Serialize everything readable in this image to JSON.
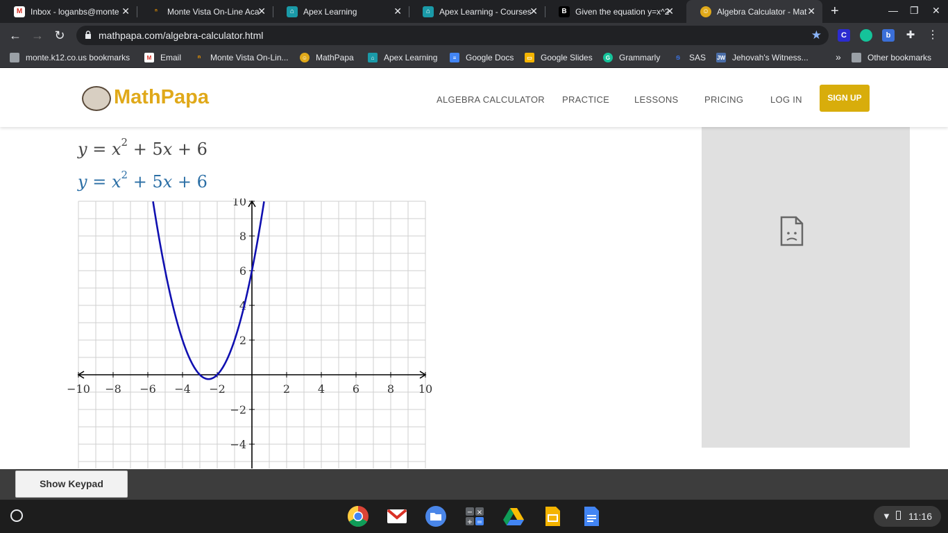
{
  "browser": {
    "tabs": [
      {
        "title": "Inbox - loganbs@monte",
        "icon": "gmail-icon"
      },
      {
        "title": "Monte Vista On-Line Aca",
        "icon": "monte-vista-icon"
      },
      {
        "title": "Apex Learning",
        "icon": "apex-icon"
      },
      {
        "title": "Apex Learning - Courses",
        "icon": "apex-icon"
      },
      {
        "title": "Given the equation y=x^2",
        "icon": "brainly-icon"
      },
      {
        "title": "Algebra Calculator - Mat",
        "icon": "mathpapa-icon",
        "active": true
      }
    ],
    "new_tab": "+",
    "url": "mathpapa.com/algebra-calculator.html",
    "extensions": [
      "C",
      "",
      "b"
    ],
    "bookmarks": [
      {
        "label": "monte.k12.co.us bookmarks",
        "icon": "folder-icon"
      },
      {
        "label": "Email",
        "icon": "gmail-icon"
      },
      {
        "label": "Monte Vista On-Lin...",
        "icon": "monte-vista-icon"
      },
      {
        "label": "MathPapa",
        "icon": "mathpapa-icon"
      },
      {
        "label": "Apex Learning",
        "icon": "apex-icon"
      },
      {
        "label": "Google Docs",
        "icon": "docs-icon"
      },
      {
        "label": "Google Slides",
        "icon": "slides-icon"
      },
      {
        "label": "Grammarly",
        "icon": "grammarly-icon"
      },
      {
        "label": "SAS",
        "icon": "sas-icon"
      },
      {
        "label": "Jehovah's Witness...",
        "icon": "jw-icon"
      }
    ],
    "overflow": "»",
    "other_bookmarks": "Other bookmarks"
  },
  "site": {
    "logo": "MathPapa",
    "nav": [
      "ALGEBRA CALCULATOR",
      "PRACTICE",
      "LESSONS",
      "PRICING",
      "LOG IN"
    ],
    "signup": "SIGN UP",
    "brand_color": "#d8ad0b"
  },
  "equation": {
    "lhs": "y",
    "eq": "=",
    "term1": "x",
    "exp": "2",
    "rest": "+ 5",
    "term2": "x",
    "const": "+ 6",
    "answer_color": "#2a6ea5"
  },
  "keypad": {
    "label": "Show Keypad"
  },
  "shelf": {
    "apps": [
      "chrome-icon",
      "gmail-icon",
      "files-icon",
      "calculator-icon",
      "drive-icon",
      "slides-icon",
      "docs-icon"
    ],
    "time": "11:16"
  },
  "chart_data": {
    "type": "line",
    "function": "y = x^2 + 5x + 6",
    "title": "",
    "xlabel": "",
    "ylabel": "",
    "xlim": [
      -10,
      10
    ],
    "ylim": [
      -5.4,
      10
    ],
    "x_ticks": [
      -10,
      -8,
      -6,
      -4,
      -2,
      2,
      4,
      6,
      8,
      10
    ],
    "y_ticks": [
      10,
      8,
      6,
      4,
      2,
      -2,
      -4
    ],
    "grid": true,
    "series": [
      {
        "color": "#1010b0",
        "x": [
          -5.7,
          -5.5,
          -5,
          -4.5,
          -4,
          -3.5,
          -3,
          -2.5,
          -2,
          -1.5,
          -1,
          -0.5,
          0,
          0.5,
          0.7
        ],
        "y": [
          10.0,
          8.75,
          6.0,
          3.75,
          2.0,
          0.75,
          0.0,
          -0.25,
          0.0,
          0.75,
          2.0,
          3.75,
          6.0,
          8.75,
          10.0
        ]
      }
    ]
  }
}
